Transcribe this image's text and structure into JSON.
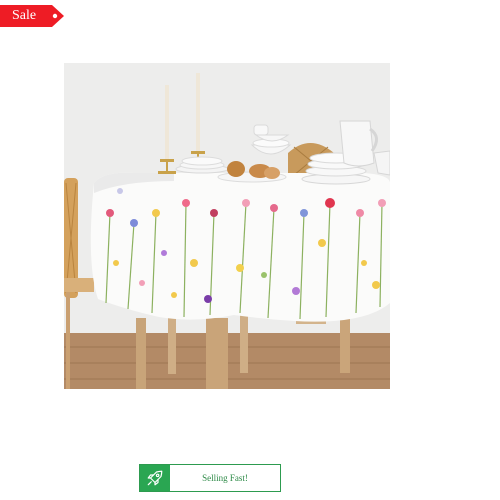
{
  "badge": {
    "label": "Sale",
    "color": "#ee1c25"
  },
  "product": {
    "image_icon": "tablecloth-photo"
  },
  "stock_badge": {
    "label": "Selling Fast!",
    "icon": "rocket-icon",
    "color": "#2aa652"
  }
}
